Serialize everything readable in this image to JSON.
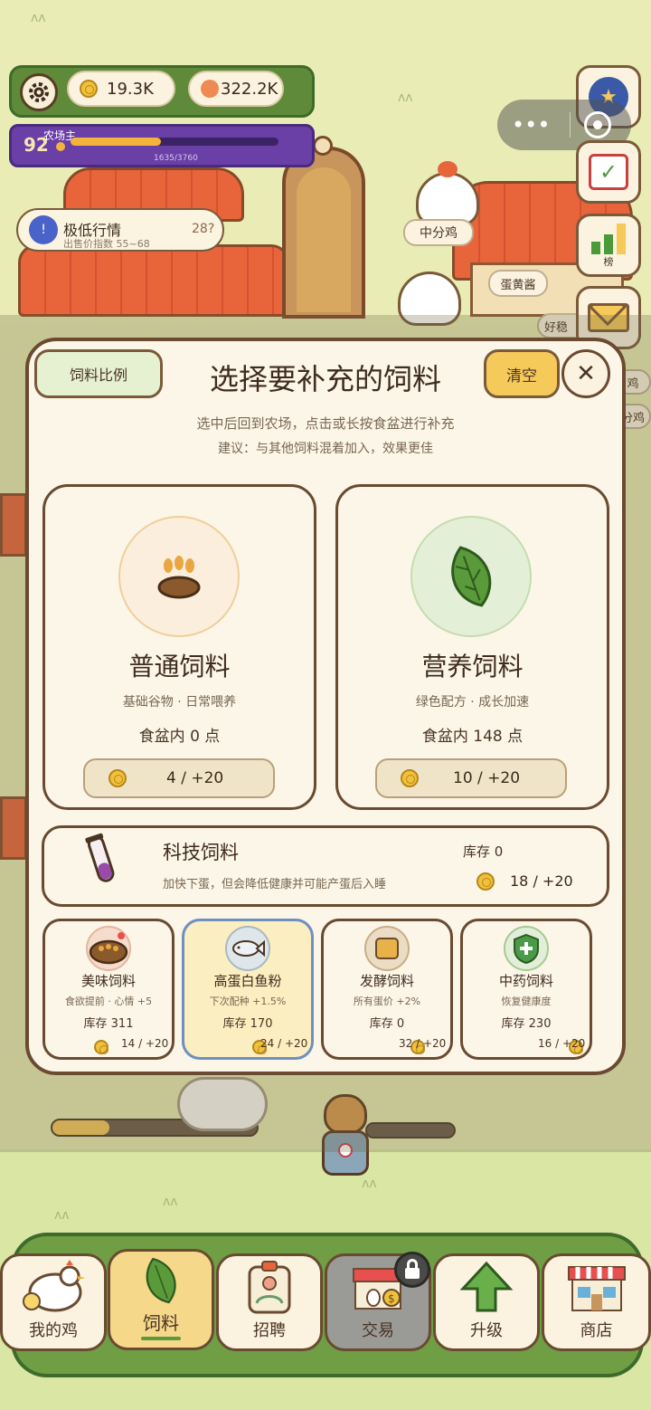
{
  "hud": {
    "coins": "19.3K",
    "gems": "322.2K",
    "level": "92",
    "rank_title": "农场主",
    "xp_text": "1635/3760",
    "xp_fraction": 0.435
  },
  "market": {
    "title": "极低行情",
    "subtitle": "出售价指数 55~68",
    "price": "28?"
  },
  "scene": {
    "sign_left": "中分鸡",
    "sign_right": "好稳",
    "shop_sign": "蛋黄酱",
    "side_sign_1": "鸡",
    "side_sign_2": "分鸡",
    "side_leaderboard": "榜"
  },
  "dialog": {
    "ratio_button": "饲料比例",
    "title": "选择要补充的饲料",
    "clear_button": "清空",
    "close_symbol": "✕",
    "hint_1": "选中后回到农场，点击或长按食盆进行补充",
    "hint_2": "建议：与其他饲料混着加入，效果更佳",
    "feeds_main": [
      {
        "name": "普通饲料",
        "desc": "基础谷物 · 日常喂养",
        "amount": "食盆内 0 点",
        "cost": "4 / +20"
      },
      {
        "name": "营养饲料",
        "desc": "绿色配方 · 成长加速",
        "amount": "食盆内 148 点",
        "cost": "10 / +20"
      }
    ],
    "tech": {
      "name": "科技饲料",
      "desc": "加快下蛋，但会降低健康并可能产蛋后入睡",
      "stock": "库存 0",
      "cost": "18 / +20"
    },
    "feeds_small": [
      {
        "name": "美味饲料",
        "desc": "食欲提前 · 心情 +5",
        "stock": "库存 311",
        "cost": "14 / +20"
      },
      {
        "name": "高蛋白鱼粉",
        "desc": "下次配种 +1.5%",
        "stock": "库存 170",
        "cost": "24 / +20"
      },
      {
        "name": "发酵饲料",
        "desc": "所有蛋价 +2%",
        "stock": "库存 0",
        "cost": "32 / +20"
      },
      {
        "name": "中药饲料",
        "desc": "恢复健康度",
        "stock": "库存 230",
        "cost": "16 / +20"
      }
    ]
  },
  "nav": {
    "items": [
      "我的鸡",
      "饲料",
      "招聘",
      "交易",
      "升级",
      "商店"
    ],
    "active": "饲料",
    "locked": "交易"
  },
  "colors": {
    "accent_green": "#6f9e44",
    "gold": "#f0c13a",
    "selected_border": "#6f8fc0",
    "purple_bar": "#6a3fa6"
  }
}
